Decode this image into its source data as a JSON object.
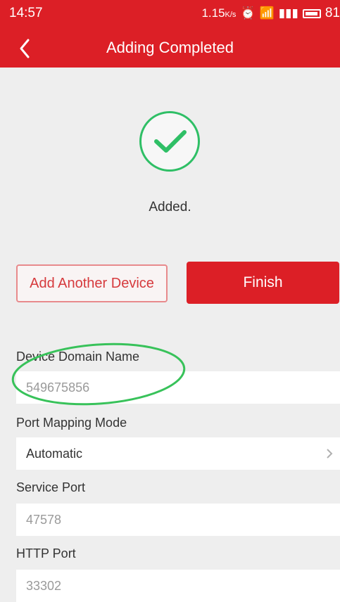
{
  "status_bar": {
    "time": "14:57",
    "speed": "1.15",
    "speed_unit": "K/s",
    "battery": "81"
  },
  "header": {
    "title": "Adding Completed"
  },
  "result": {
    "message": "Added."
  },
  "actions": {
    "add_another_label": "Add Another Device",
    "finish_label": "Finish"
  },
  "form": {
    "domain_name_label": "Device Domain Name",
    "domain_name_value": "549675856",
    "port_mapping_label": "Port Mapping Mode",
    "port_mapping_value": "Automatic",
    "service_port_label": "Service Port",
    "service_port_value": "47578",
    "http_port_label": "HTTP Port",
    "http_port_value": "33302"
  },
  "colors": {
    "brand": "#dc1f26",
    "success": "#2fbf66",
    "annotation": "#38c25a"
  }
}
